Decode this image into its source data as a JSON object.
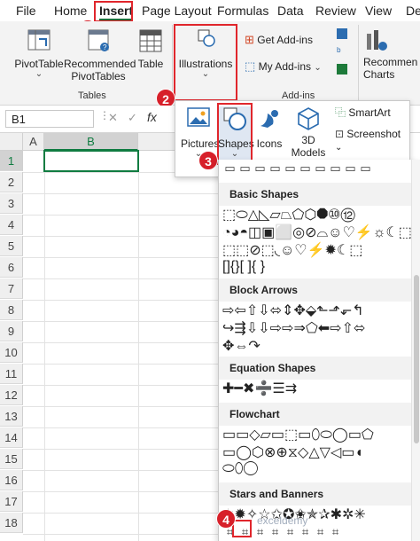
{
  "tabs": [
    "File",
    "Home",
    "Insert",
    "Page Layout",
    "Formulas",
    "Data",
    "Review",
    "View",
    "De"
  ],
  "ribbon": {
    "pivot_table": "PivotTable",
    "recommended_pivot_line1": "Recommended",
    "recommended_pivot_line2": "PivotTables",
    "table": "Table",
    "tables_group": "Tables",
    "illustrations": "Illustrations",
    "get_addins": "Get Add-ins",
    "my_addins": "My Add-ins",
    "addins_group": "Add-ins",
    "recommended_charts_line1": "Recommen",
    "recommended_charts_line2": "Charts"
  },
  "illustrations_menu": {
    "pictures": "Pictures",
    "shapes": "Shapes",
    "icons": "Icons",
    "models_line1": "3D",
    "models_line2": "Models",
    "smartart": "SmartArt",
    "screenshot": "Screenshot"
  },
  "formula_bar": {
    "name_box": "B1",
    "x_symbol": "✕",
    "check_symbol": "✓",
    "fx": "fx"
  },
  "sheet": {
    "columns": [
      "A",
      "B"
    ],
    "rows": [
      "1",
      "2",
      "3",
      "4",
      "5",
      "6",
      "7",
      "8",
      "9",
      "10",
      "11",
      "12",
      "13",
      "14",
      "15",
      "16",
      "17",
      "18"
    ]
  },
  "shapes_panel": {
    "sections": [
      "Basic Shapes",
      "Block Arrows",
      "Equation Shapes",
      "Flowchart",
      "Stars and Banners"
    ],
    "basic_row1": "⬚⬭△◺▱⏢⬠⬡⯃⑩⑫",
    "basic_row2": "◔◕◓◫▣⬜◎⊘⌓☺♡⚡☼☾⬚",
    "basic_row3": "⬚⬚⊘⬚◟☺♡⚡✹☾⬚",
    "basic_row4": "[]{}[ ]{ }",
    "arrows_row1": "⇨⇦⇧⇩⬄⇕✥⬙⬑⬏⬐↰",
    "arrows_row2": "↪⇶⇩⇩⇨⇨⇒⬠⬅⇨⇧⬄",
    "arrows_row3": "✥⇔↷",
    "equation_row": "✚━✖➗☰⇉",
    "flow_row1": "▭▭◇▱▭⬚▭⬯⬭◯▭⬠",
    "flow_row2": "▭◯⬡⊗⊕⧖◇△▽◁▭◖",
    "flow_row3": "⬭⬯◯",
    "stars_row": "✶✹✧☆✩✪✬✯✰✱✲✳"
  },
  "badges": [
    "1",
    "2",
    "3",
    "4"
  ],
  "watermark": "exceldemy",
  "colors": {
    "accent": "#107c41",
    "highlight": "#e0262c",
    "badge": "#d7202a"
  }
}
